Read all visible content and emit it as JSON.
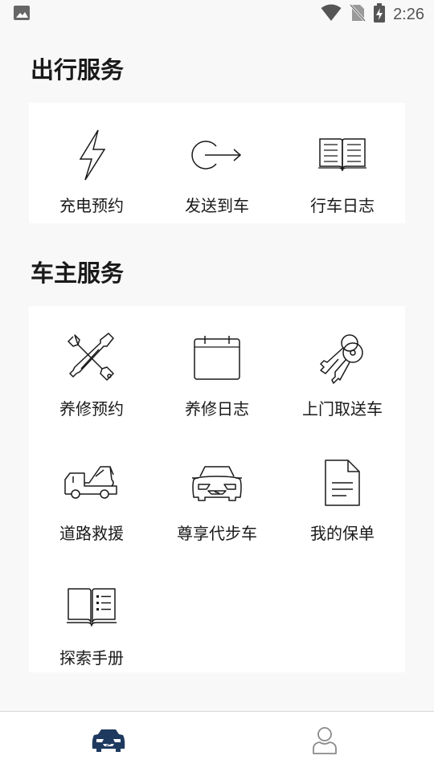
{
  "status_bar": {
    "time": "2:26",
    "icons": [
      "image-icon",
      "wifi-icon",
      "no-sim-icon",
      "battery-charging-icon"
    ]
  },
  "sections": {
    "travel": {
      "title": "出行服务",
      "items": [
        {
          "label": "充电预约",
          "icon": "lightning-icon"
        },
        {
          "label": "发送到车",
          "icon": "send-to-car-icon"
        },
        {
          "label": "行车日志",
          "icon": "open-book-icon"
        }
      ]
    },
    "owner": {
      "title": "车主服务",
      "items": [
        {
          "label": "养修预约",
          "icon": "tools-icon"
        },
        {
          "label": "养修日志",
          "icon": "calendar-icon"
        },
        {
          "label": "上门取送车",
          "icon": "car-keys-icon"
        },
        {
          "label": "道路救援",
          "icon": "tow-truck-icon"
        },
        {
          "label": "尊享代步车",
          "icon": "car-front-icon"
        },
        {
          "label": "我的保单",
          "icon": "document-icon"
        },
        {
          "label": "探索手册",
          "icon": "manual-book-icon"
        }
      ]
    }
  },
  "bottom_nav": {
    "items": [
      {
        "icon": "car-tab-icon",
        "active": true
      },
      {
        "icon": "profile-tab-icon",
        "active": false
      }
    ]
  },
  "colors": {
    "background": "#f8f8f8",
    "card": "#ffffff",
    "active_tab": "#1f3a5f",
    "inactive_tab": "#8a8a8a",
    "text": "#1a1a1a"
  }
}
